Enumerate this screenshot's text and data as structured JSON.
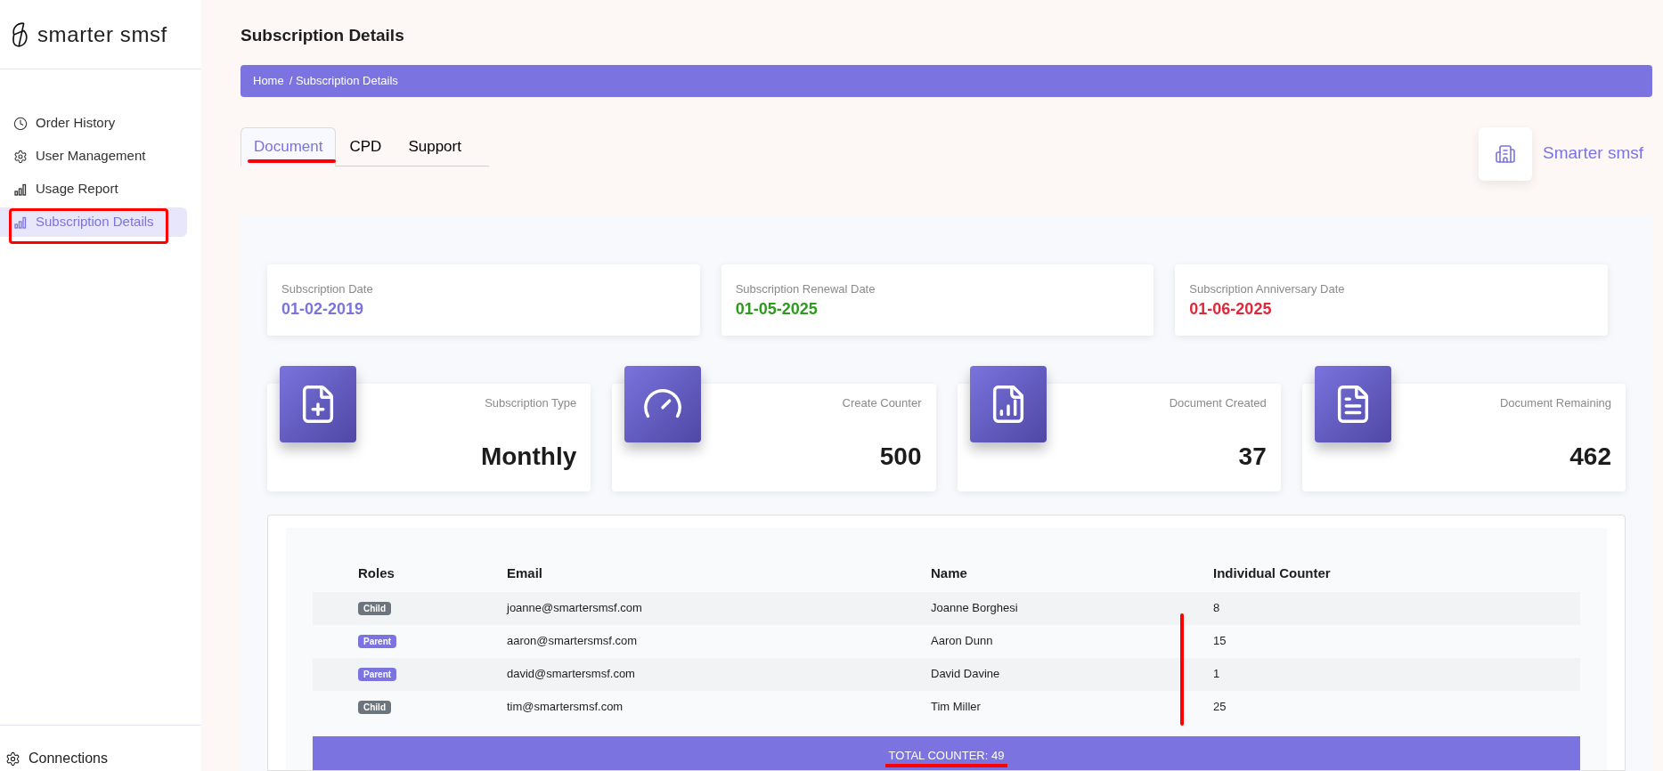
{
  "brand": {
    "name": "smarter smsf"
  },
  "sidebar": {
    "items": [
      {
        "label": "Order History",
        "selected": false
      },
      {
        "label": "User Management",
        "selected": false
      },
      {
        "label": "Usage Report",
        "selected": false
      },
      {
        "label": "Subscription Details",
        "selected": true
      }
    ],
    "footer_item": {
      "label": "Connections"
    }
  },
  "page": {
    "title": "Subscription Details",
    "breadcrumb": [
      "Home",
      "/ Subscription Details"
    ]
  },
  "tabs": [
    {
      "label": "Document",
      "selected": true
    },
    {
      "label": "CPD",
      "selected": false
    },
    {
      "label": "Support",
      "selected": false
    }
  ],
  "company": {
    "name": "Smarter smsf"
  },
  "dates": [
    {
      "label": "Subscription Date",
      "value": "01-02-2019",
      "color": "#7b74e0"
    },
    {
      "label": "Subscription Renewal Date",
      "value": "01-05-2025",
      "color": "#2e9a1f"
    },
    {
      "label": "Subscription Anniversary Date",
      "value": "01-06-2025",
      "color": "#dc2a3a"
    }
  ],
  "stats": [
    {
      "label": "Subscription Type",
      "value": "Monthly"
    },
    {
      "label": "Create Counter",
      "value": "500"
    },
    {
      "label": "Document Created",
      "value": "37"
    },
    {
      "label": "Document Remaining",
      "value": "462"
    }
  ],
  "table": {
    "columns": [
      "Roles",
      "Email",
      "Name",
      "Individual Counter"
    ],
    "rows": [
      {
        "role": {
          "label": "Child",
          "color": "#6c757d"
        },
        "email": "joanne@smartersmsf.com",
        "name": "Joanne Borghesi",
        "counter": "8"
      },
      {
        "role": {
          "label": "Parent",
          "color": "#7b74e0"
        },
        "email": "aaron@smartersmsf.com",
        "name": "Aaron Dunn",
        "counter": "15"
      },
      {
        "role": {
          "label": "Parent",
          "color": "#7b74e0"
        },
        "email": "david@smartersmsf.com",
        "name": "David Davine",
        "counter": "1"
      },
      {
        "role": {
          "label": "Child",
          "color": "#6c757d"
        },
        "email": "tim@smartersmsf.com",
        "name": "Tim Miller",
        "counter": "25"
      }
    ],
    "total": "TOTAL COUNTER: 49"
  }
}
